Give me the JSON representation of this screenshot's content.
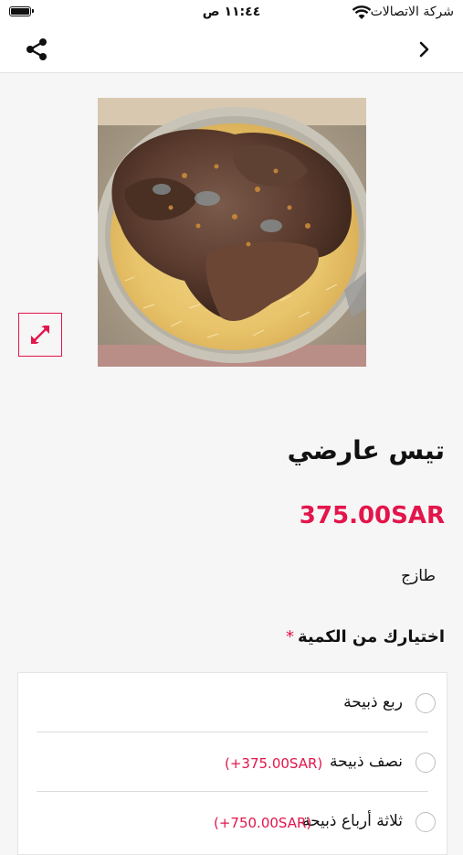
{
  "status_bar": {
    "carrier": "شركة الاتصالات",
    "time": "١١:٤٤ ص"
  },
  "navbar": {
    "share_icon": "share-icon",
    "back_icon": "chevron-right-icon"
  },
  "product": {
    "image_alt": "mandi goat dish on rice",
    "expand_icon": "expand-arrows-icon",
    "title": "تيس عارضي",
    "price": "375.00SAR",
    "description": "طازج"
  },
  "quantity_section": {
    "title": "اختيارك من الكمية",
    "required_mark": "*",
    "options": [
      {
        "label": "ربع ذبيحة",
        "extra": ""
      },
      {
        "label": "نصف ذبيحة",
        "extra": "(+375.00SAR)"
      },
      {
        "label": "ثلاثة أرباع ذبيحة",
        "extra": "(+750.00SAR)"
      }
    ]
  },
  "colors": {
    "accent": "#e3154b",
    "background": "#f6f6f6",
    "card": "#ffffff"
  }
}
